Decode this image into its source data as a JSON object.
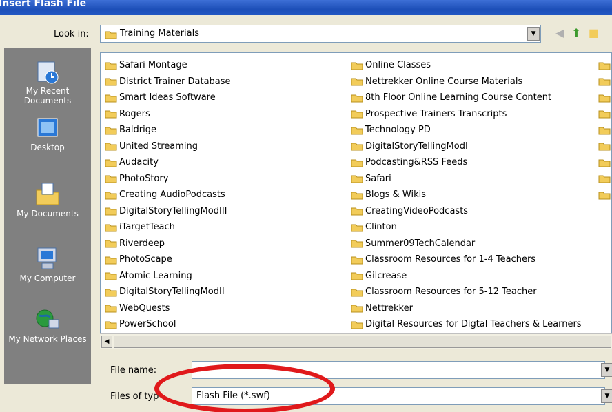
{
  "window": {
    "title": "Insert Flash File"
  },
  "look_in": {
    "label": "Look in:",
    "value": "Training Materials"
  },
  "places": [
    {
      "label": "My Recent Documents",
      "icon": "recent-documents-icon"
    },
    {
      "label": "Desktop",
      "icon": "desktop-icon"
    },
    {
      "label": "My Documents",
      "icon": "my-documents-icon"
    },
    {
      "label": "My Computer",
      "icon": "my-computer-icon"
    },
    {
      "label": "My Network Places",
      "icon": "network-places-icon"
    }
  ],
  "files": {
    "col1": [
      "Safari Montage",
      "District Trainer Database",
      "Smart Ideas Software",
      "Rogers",
      "Baldrige",
      "United Streaming",
      "Audacity",
      "PhotoStory",
      "Creating AudioPodcasts",
      "DigitalStoryTellingModIII",
      "iTargetTeach",
      "Riverdeep",
      "PhotoScape",
      "Atomic Learning",
      "DigitalStoryTellingModII",
      "WebQuests",
      "PowerSchool"
    ],
    "col2": [
      "Online Classes",
      "Nettrekker Online Course Materials",
      "8th Floor Online Learning Course Content",
      "Prospective Trainers Transcripts",
      "Technology PD",
      "DigitalStoryTellingModI",
      "Podcasting&RSS Feeds",
      "Safari",
      "Blogs & Wikis",
      "CreatingVideoPodcasts",
      "Clinton",
      "Summer09TechCalendar",
      "Classroom Resources for 1-4 Teachers",
      "Gilcrease",
      "Classroom Resources for 5-12 Teacher",
      "Nettrekker",
      "Digital Resources for Digtal Teachers & Learners"
    ]
  },
  "file_name": {
    "label": "File name:",
    "value": ""
  },
  "files_of_type": {
    "label": "Files of typ",
    "value": "Flash File (*.swf)"
  },
  "colors": {
    "highlight": "#e0191b",
    "folder": "#f2cc5a",
    "titlebar": "#2257c3"
  }
}
